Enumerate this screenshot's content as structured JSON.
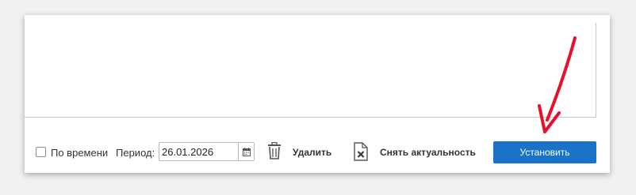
{
  "footer": {
    "checkbox_label": "По времени",
    "period_label": "Период:",
    "date_value": "26.01.2026",
    "delete_label": "Удалить",
    "unset_label": "Снять актуальность",
    "set_button": "Установить"
  },
  "colors": {
    "primary_button": "#1a73c8",
    "annotation_arrow": "#e8102a"
  },
  "icons": {
    "calendar": "calendar-icon",
    "trash": "trash-icon",
    "doc_remove": "document-x-icon",
    "arrow": "annotation-arrow-icon"
  }
}
